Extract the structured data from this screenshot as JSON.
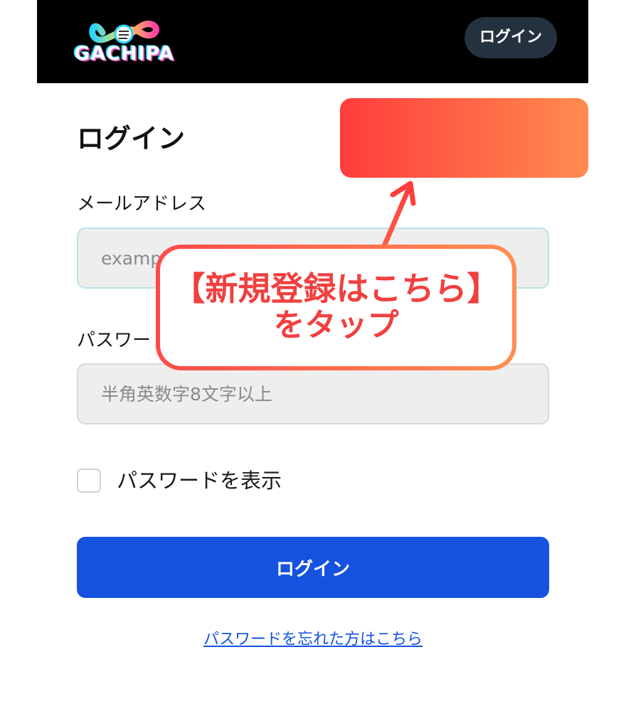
{
  "header": {
    "logo_text": "GACHIPA",
    "login_button_label": "ログイン"
  },
  "form": {
    "title": "ログイン",
    "register_link": "新規登録はこちら",
    "email_label": "メールアドレス",
    "email_placeholder": "example@gachipa.jp",
    "password_label": "パスワード",
    "password_placeholder": "半角英数字8文字以上",
    "show_password_label": "パスワードを表示",
    "show_password_checked": false,
    "submit_label": "ログイン",
    "forgot_password_link": "パスワードを忘れた方はこちら"
  },
  "annotation": {
    "callout_line1": "【新規登録はこちら】",
    "callout_line2": "をタップ"
  },
  "colors": {
    "header_bg": "#000000",
    "primary": "#1552e0",
    "annotation_red": "#f0403f",
    "annotation_orange": "#ff8b4f"
  },
  "icons": {
    "logo": "gachipa-infinity-fist-logo",
    "arrow": "up-arrow-pointer"
  }
}
